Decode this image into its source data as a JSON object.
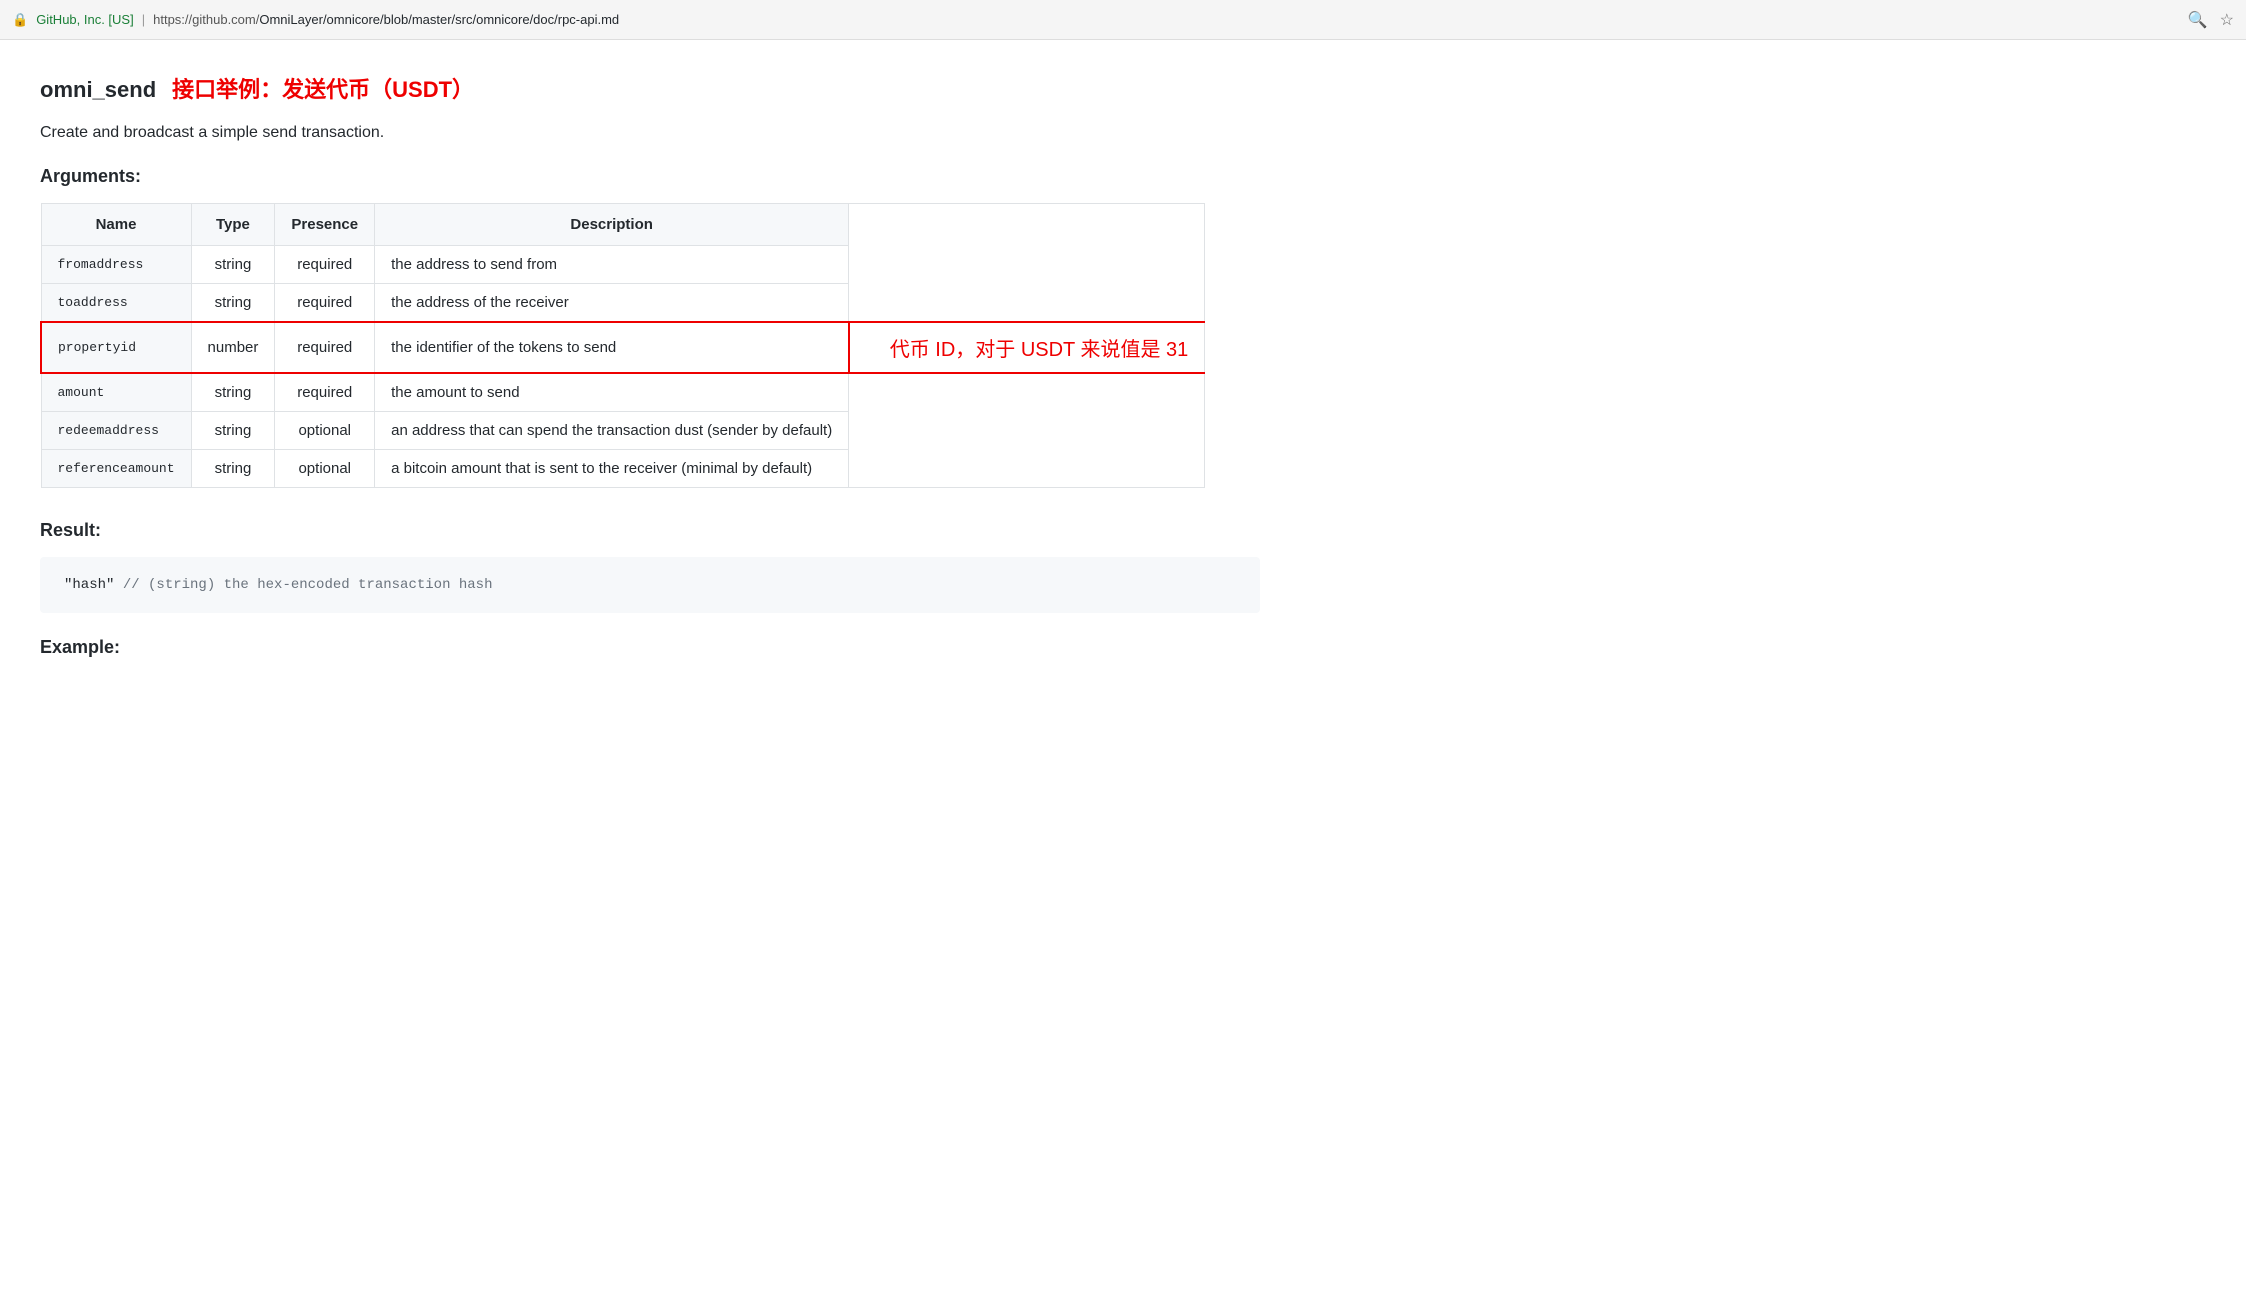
{
  "browser": {
    "secure_label": "GitHub, Inc. [US]",
    "url_base": "https://github.com/",
    "url_path": "OmniLayer/omnicore/blob/master/src/omnicore/doc/rpc-api.md",
    "search_icon": "🔍",
    "star_icon": "☆"
  },
  "page": {
    "api_name": "omni_send",
    "subtitle": "接口举例：发送代币（USDT）",
    "description": "Create and broadcast a simple send transaction.",
    "arguments_heading": "Arguments:",
    "result_heading": "Result:",
    "example_heading": "Example:"
  },
  "table": {
    "headers": {
      "name": "Name",
      "type": "Type",
      "presence": "Presence",
      "description": "Description"
    },
    "rows": [
      {
        "name": "fromaddress",
        "type": "string",
        "presence": "required",
        "description": "the address to send from",
        "highlighted": false
      },
      {
        "name": "toaddress",
        "type": "string",
        "presence": "required",
        "description": "the address of the receiver",
        "highlighted": false
      },
      {
        "name": "propertyid",
        "type": "number",
        "presence": "required",
        "description": "the identifier of the tokens to send",
        "highlighted": true,
        "annotation": "代币 ID，对于 USDT 来说值是 31"
      },
      {
        "name": "amount",
        "type": "string",
        "presence": "required",
        "description": "the amount to send",
        "highlighted": false
      },
      {
        "name": "redeemaddress",
        "type": "string",
        "presence": "optional",
        "description": "an address that can spend the transaction dust (sender by default)",
        "highlighted": false
      },
      {
        "name": "referenceamount",
        "type": "string",
        "presence": "optional",
        "description": "a bitcoin amount that is sent to the receiver (minimal by default)",
        "highlighted": false
      }
    ]
  },
  "result": {
    "code": "\"hash\"  // (string) the hex-encoded transaction hash"
  }
}
